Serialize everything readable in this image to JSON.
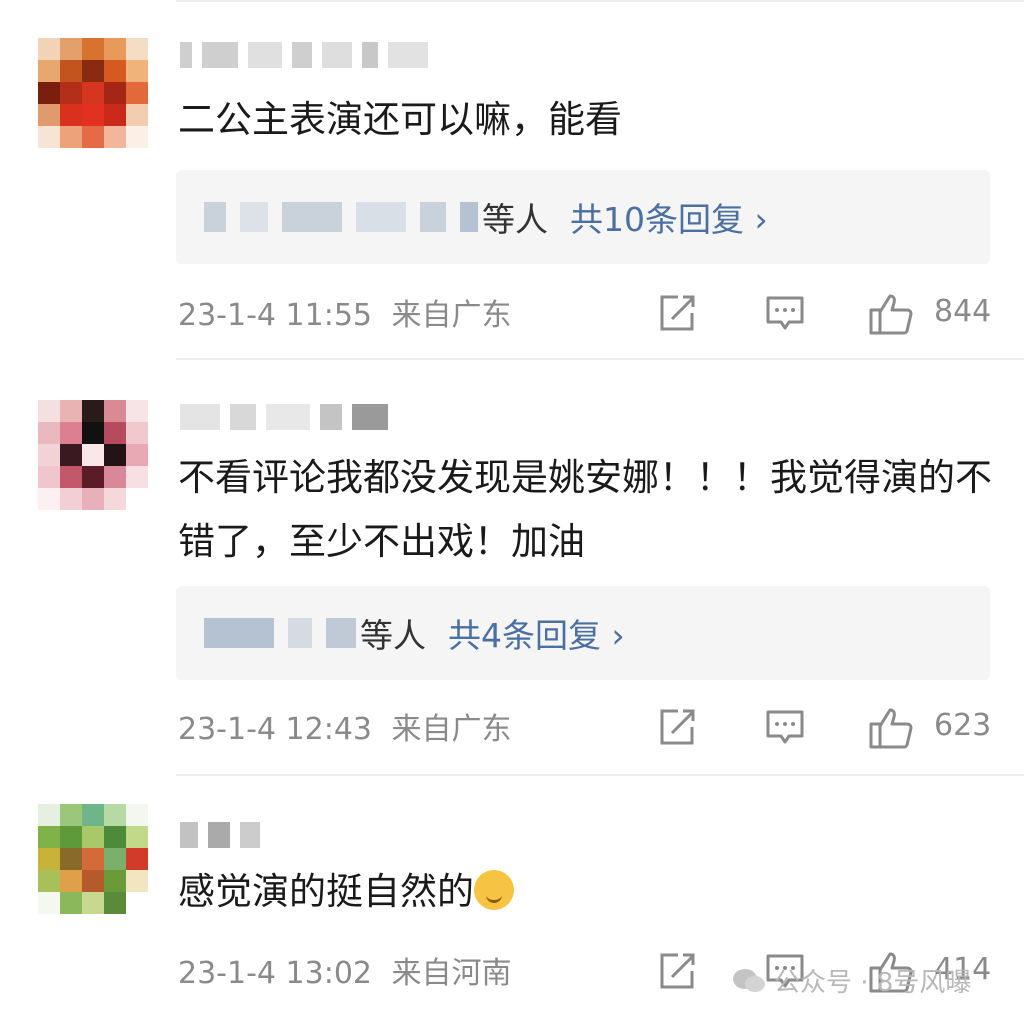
{
  "comments": [
    {
      "text": "二公主表演还可以嘛，能看",
      "reply_suffix": "等人",
      "reply_link": "共10条回复 ›",
      "time": "23-1-4 11:55",
      "location": "来自广东",
      "likes": "844"
    },
    {
      "text": "不看评论我都没发现是姚安娜！！！我觉得演的不错了，至少不出戏！加油",
      "reply_suffix": "等人",
      "reply_link": "共4条回复 ›",
      "time": "23-1-4 12:43",
      "location": "来自广东",
      "likes": "623"
    },
    {
      "text": "感觉演的挺自然的",
      "time": "23-1-4 13:02",
      "location": "来自河南",
      "likes": "414"
    }
  ],
  "icons": {
    "share": "share-icon",
    "comment": "comment-icon",
    "like": "thumb-up-icon",
    "emoji": "shy-face-emoji-icon"
  },
  "watermark": {
    "text": "公众号 · 8号风曝"
  },
  "colors": {
    "link": "#4a6fa0",
    "meta": "#8a8a8a",
    "reply_bg": "#f5f5f5"
  }
}
